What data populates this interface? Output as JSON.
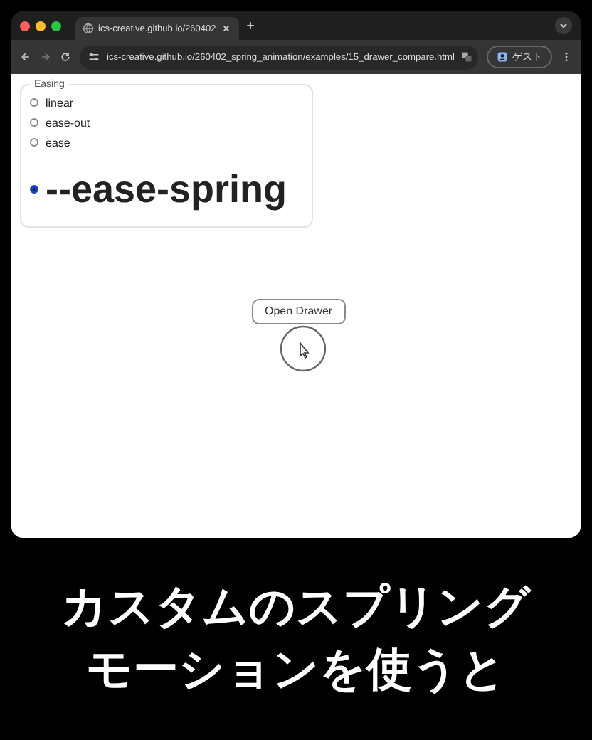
{
  "browser": {
    "tab_title": "ics-creative.github.io/260402",
    "url": "ics-creative.github.io/260402_spring_animation/examples/15_drawer_compare.html",
    "profile": "ゲスト"
  },
  "easing": {
    "legend": "Easing",
    "options": [
      {
        "label": "linear",
        "selected": false
      },
      {
        "label": "ease-out",
        "selected": false
      },
      {
        "label": "ease",
        "selected": false
      },
      {
        "label": "--ease-spring",
        "selected": true
      }
    ]
  },
  "open_button": "Open Drawer",
  "caption": [
    "カスタムのスプリング",
    "モーションを使うと"
  ]
}
